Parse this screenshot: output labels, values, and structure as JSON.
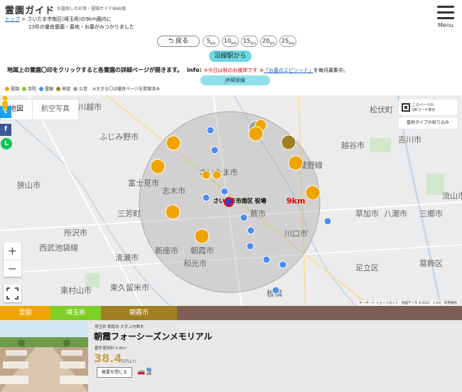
{
  "header": {
    "logo": "霊園ガイド",
    "tagline": "お墓探しのお供・霊園ガイドWeb版",
    "crumb_home": "トップ",
    "crumb_line1": " > さいたま市南区(埼玉県)の9km圏内に",
    "crumb_line2": "23件の優良霊園・墓地・お墓がみつかりました",
    "menu_label": "Menu"
  },
  "controls": {
    "back": "戻る",
    "radius": [
      "5",
      "10",
      "15",
      "20",
      "25"
    ],
    "unit": "km",
    "line_button": "沿線駅から",
    "station_button": "JR埼京線"
  },
  "info": {
    "main": "地図上の霊園〇印をクリックすると各霊園の詳細ページが開きます。",
    "label": "info:",
    "notice": "※今日は秋のお彼岸です",
    "link_prefix": "※",
    "link": "「お墓のエピソード」",
    "tail": "を毎月募集中。"
  },
  "legend": {
    "items": [
      {
        "label": "霊園",
        "color": "#f0a400"
      },
      {
        "label": "寺院",
        "color": "#7fcf26"
      },
      {
        "label": "霊廟",
        "color": "#4a8cf0"
      },
      {
        "label": "神道",
        "color": "#a08020"
      },
      {
        "label": "公営",
        "color": "#a0a0a0"
      }
    ],
    "note": "※大きな〇は優良ページを提案済み"
  },
  "map": {
    "tab_map": "地図",
    "tab_satellite": "航空写真",
    "qr_text_1": "このページの",
    "qr_text_2": "QRコード表示",
    "map_type": "墓地タイプの絞り込み",
    "radius_label": "9km",
    "center_label": "さいたま市南区 役場",
    "footer": "キーボード ショートカット　地図データ ©2021　2 km　利用規約",
    "places": [
      {
        "name": "川越市"
      },
      {
        "name": "松伏町"
      },
      {
        "name": "ふじみ野市"
      },
      {
        "name": "さいたま市"
      },
      {
        "name": "越谷市"
      },
      {
        "name": "吉川市"
      },
      {
        "name": "富士見市"
      },
      {
        "name": "武蔵野線"
      },
      {
        "name": "狭山市"
      },
      {
        "name": "志木市"
      },
      {
        "name": "蕨市"
      },
      {
        "name": "草加市"
      },
      {
        "name": "三芳町"
      },
      {
        "name": "八潮市"
      },
      {
        "name": "三郷市"
      },
      {
        "name": "所沢市"
      },
      {
        "name": "川口市"
      },
      {
        "name": "西武池袋線"
      },
      {
        "name": "清瀬市"
      },
      {
        "name": "新座市"
      },
      {
        "name": "朝霞市"
      },
      {
        "name": "和光市"
      },
      {
        "name": "足立区"
      },
      {
        "name": "葛飾区"
      },
      {
        "name": "東久留米市"
      },
      {
        "name": "東村山市"
      },
      {
        "name": "板橋"
      },
      {
        "name": "流山市"
      }
    ]
  },
  "categories": [
    "霊園",
    "埼玉県",
    "朝霞市"
  ],
  "listing": {
    "meta": "埼玉県 朝霞市 大字上内間木",
    "title": "朝霞フォーシーズンメモリアル",
    "sub": "墓所使用料 0.8m²",
    "price": "38.4",
    "unit": "万円より",
    "close": "概要を閉じる"
  }
}
